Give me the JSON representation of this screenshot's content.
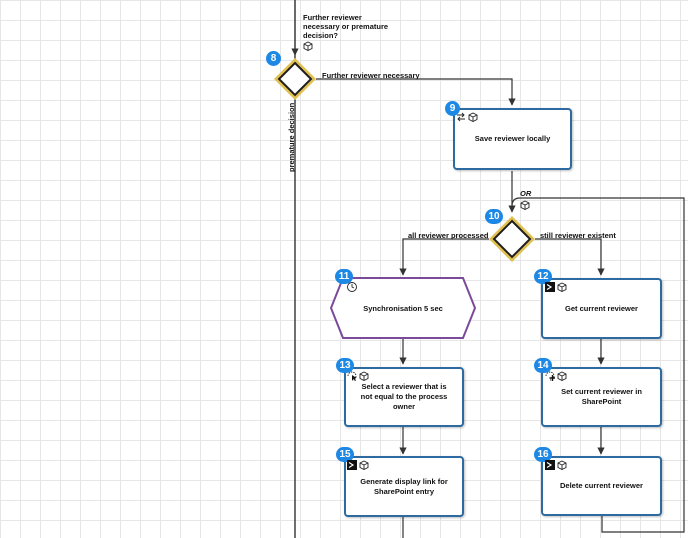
{
  "decision_8": {
    "number": "8",
    "question": "Further reviewer necessary or premature decision?",
    "branch_yes": "Further reviewer necessary",
    "branch_no": "premature decision"
  },
  "task_9": {
    "number": "9",
    "label": "Save reviewer locally"
  },
  "join": {
    "label": "OR"
  },
  "decision_10": {
    "number": "10",
    "branch_left": "all reviewer processed",
    "branch_right": "still reviewer existent"
  },
  "event_11": {
    "number": "11",
    "label": "Synchronisation 5 sec"
  },
  "task_12": {
    "number": "12",
    "label": "Get current reviewer"
  },
  "task_13": {
    "number": "13",
    "label": "Select a reviewer that is not equal to the process owner"
  },
  "task_14": {
    "number": "14",
    "label": "Set current reviewer in SharePoint"
  },
  "task_15": {
    "number": "15",
    "label": "Generate display link for SharePoint entry"
  },
  "task_16": {
    "number": "16",
    "label": "Delete current reviewer"
  },
  "colors": {
    "task_border": "#2d6a9f",
    "gateway_fill": "#1f1f1f",
    "gateway_border": "#e0c050",
    "event_border": "#7b4a9a",
    "badge": "#1e88e5",
    "connector": "#333333"
  }
}
